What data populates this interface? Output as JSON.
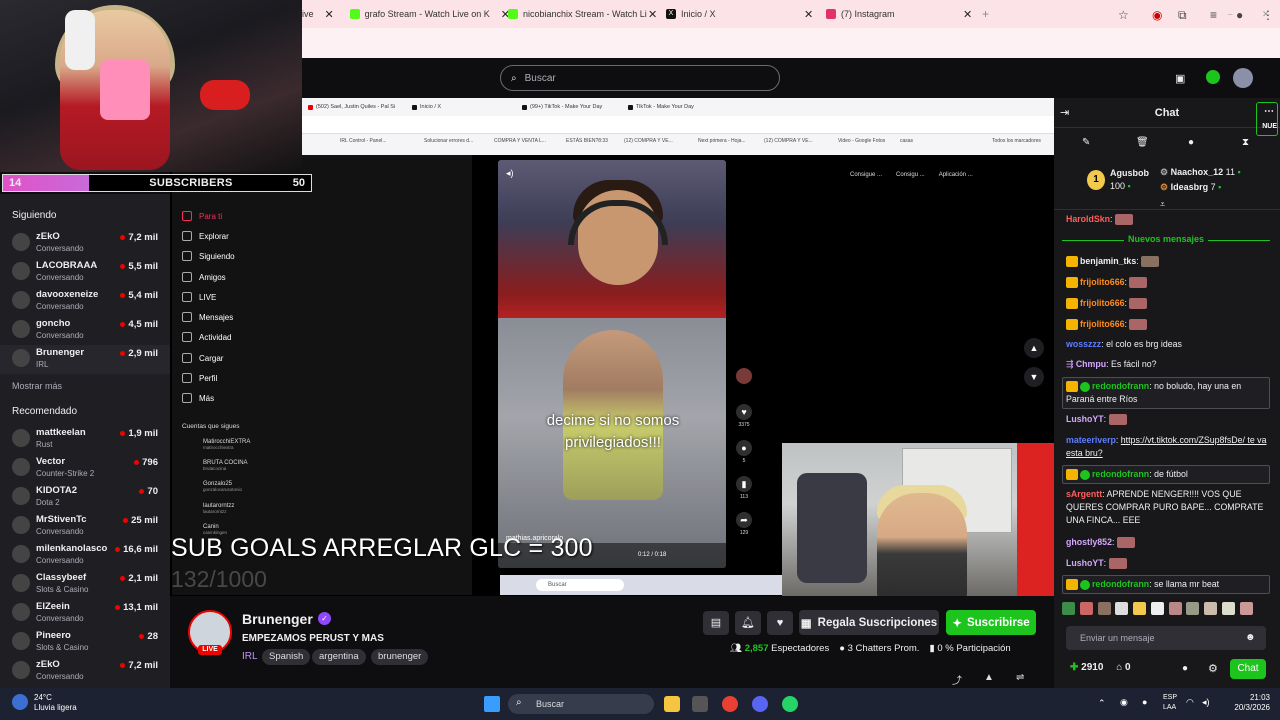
{
  "browser": {
    "tabs": [
      {
        "label": "ive",
        "color": "#9146ff"
      },
      {
        "label": "grafo Stream - Watch Live on K",
        "color": "#53fc18"
      },
      {
        "label": "nicobianchix Stream - Watch Li",
        "color": "#53fc18"
      },
      {
        "label": "Inicio / X",
        "color": "#111111"
      },
      {
        "label": "(7) Instagram",
        "color": "#e1306c"
      }
    ],
    "new_tab": "+"
  },
  "twitch": {
    "search_placeholder": "Buscar",
    "sidebar": {
      "following_header": "Siguiendo",
      "following": [
        {
          "name": "zEkO",
          "category": "Conversando",
          "viewers": "7,2 mil"
        },
        {
          "name": "LACOBRAAA",
          "category": "Conversando",
          "viewers": "5,5 mil"
        },
        {
          "name": "davooxeneize",
          "category": "Conversando",
          "viewers": "5,4 mil"
        },
        {
          "name": "goncho",
          "category": "Conversando",
          "viewers": "4,5 mil"
        },
        {
          "name": "Brunenger",
          "category": "IRL",
          "viewers": "2,9 mil"
        }
      ],
      "show_more": "Mostrar más",
      "recommended_header": "Recomendado",
      "recommended": [
        {
          "name": "mattkeelan",
          "category": "Rust",
          "viewers": "1,9 mil"
        },
        {
          "name": "Vector",
          "category": "Counter-Strike 2",
          "viewers": "796"
        },
        {
          "name": "KIDOTA2",
          "category": "Dota 2",
          "viewers": "70"
        },
        {
          "name": "MrStivenTc",
          "category": "Conversando",
          "viewers": "25 mil"
        },
        {
          "name": "milenkanolasco",
          "category": "Conversando",
          "viewers": "16,6 mil"
        },
        {
          "name": "Classybeef",
          "category": "Slots & Casino",
          "viewers": "2,1 mil"
        },
        {
          "name": "ElZeein",
          "category": "Conversando",
          "viewers": "13,1 mil"
        },
        {
          "name": "Pineero",
          "category": "Slots & Casino",
          "viewers": "28"
        },
        {
          "name": "zEkO",
          "category": "Conversando",
          "viewers": "7,2 mil"
        }
      ]
    },
    "overlay": {
      "sub_count": "14",
      "sub_label": "SUBSCRIBERS",
      "sub_goal": "50",
      "sub_progress": 0.28,
      "goals_text": "SUB GOALS ARREGLAR GLC = 300",
      "goals_count": "132/1000"
    },
    "stream_content": {
      "inner_tabs": [
        "(502) Sael, Justin Quiles - Pal Si",
        "Inicio / X",
        "(99+) TikTok - Make Your Day",
        "TikTok - Make Your Day"
      ],
      "inner_bookmarks": [
        "IRL Control - Panel...",
        "Solucionar errores d...",
        "COMPRA Y VENTA L...",
        "ESTÁS BIEN?8:33",
        "(12) COMPRA Y VE...",
        "(12) COMPRA Y VE...",
        "Next primera - Hoja...",
        "(12) COMPRA Y VE...",
        "Video - Google Fotos",
        "casas",
        "Todos los marcadores"
      ],
      "tiktok_nav": [
        "Para ti",
        "Explorar",
        "Siguiendo",
        "Amigos",
        "LIVE",
        "Mensajes",
        "Actividad",
        "Cargar",
        "Perfil",
        "Más"
      ],
      "tiktok_follow_header": "Cuentas que sigues",
      "tiktok_following": [
        {
          "name": "MatirocchiEXTRA",
          "handle": "matirocchiextra"
        },
        {
          "name": "BRUTA COCINA",
          "handle": "brutacocina"
        },
        {
          "name": "Gonzalo25",
          "handle": "gonzalocarusotonio"
        },
        {
          "name": "lautarorntzz",
          "handle": "lautarorntzz"
        },
        {
          "name": "Canin",
          "handle": "caninkingen"
        }
      ],
      "tiktok_top_actions": [
        "Consigue ...",
        "Consigu ...",
        "Aplicación ..."
      ],
      "video_caption": "decime si no somos privilegiados!!!",
      "video_user": "mathias.apricoralo",
      "video_time": "0:12 / 0:18",
      "action_counts": [
        "3375",
        "5",
        "113",
        "129"
      ],
      "inner_search": "Buscar"
    },
    "channel": {
      "name": "Brunenger",
      "live_badge": "LIVE",
      "title": "EMPEZAMOS PERUST Y MAS",
      "category": "IRL",
      "tags": [
        "Spanish",
        "argentina",
        "brunenger"
      ],
      "gift_button": "Regala Suscripciones",
      "subscribe_button": "Suscribirse",
      "viewers": "2,857",
      "viewers_label": "Espectadores",
      "chatters": "3",
      "chatters_label": "Chatters Prom.",
      "participation": "0 %",
      "participation_label": "Participación"
    },
    "chat": {
      "title": "Chat",
      "corner_badge": "NUE",
      "leaderboard": [
        {
          "name": "Agusbob",
          "value": "100"
        },
        {
          "name": "Naachox_12",
          "value": "11"
        },
        {
          "name": "Ideasbrg",
          "value": "7"
        }
      ],
      "new_messages": "Nuevos mensajes",
      "messages": [
        {
          "user": "HaroldSkn",
          "text": "",
          "color": "#ff4f4f"
        },
        {
          "user": "benjamin_tks",
          "text": "",
          "color": "#efeff1"
        },
        {
          "user": "frijolito666",
          "text": "",
          "color": "#ff8c1a"
        },
        {
          "user": "frijolito666",
          "text": "",
          "color": "#ff8c1a"
        },
        {
          "user": "frijolito666",
          "text": "",
          "color": "#ff8c1a"
        },
        {
          "user": "wosszzz",
          "text": "el colo es brg ideas",
          "color": "#5f7dff"
        },
        {
          "user": "Chmpu",
          "text": "Es fácil no?",
          "color": "#d5a6ff"
        },
        {
          "user": "redondofrann",
          "text": "no boludo, hay una en Paraná entre Ríos",
          "color": "#1ec41e"
        },
        {
          "user": "LushoYT",
          "text": "",
          "color": "#d5a6ff"
        },
        {
          "user": "mateeriverp",
          "text": "https://vt.tiktok.com/ZSup8fsDe/ te va esta bru?",
          "color": "#5f7dff"
        },
        {
          "user": "redondofrann",
          "text": "de fútbol",
          "color": "#1ec41e"
        },
        {
          "user": "sArgentt",
          "text": "APRENDE NENGER!!!! VOS QUE QUERES COMPRAR PURO BAPE... COMPRATE UNA FINCA... EEE",
          "color": "#ff5e5e"
        },
        {
          "user": "ghostly852",
          "text": "",
          "color": "#d5a6ff"
        },
        {
          "user": "LushoYT",
          "text": "",
          "color": "#d5a6ff"
        },
        {
          "user": "redondofrann",
          "text": "se llama mr beat",
          "color": "#1ec41e"
        }
      ],
      "input_placeholder": "Enviar un mensaje",
      "points": "2910",
      "second_count": "0",
      "chat_button": "Chat"
    }
  },
  "taskbar": {
    "weather_temp": "24°C",
    "weather_desc": "Lluvia ligera",
    "search": "Buscar",
    "lang1": "ESP",
    "lang2": "LAA",
    "time": "21:03",
    "date": "20/3/2026"
  },
  "colors": {
    "accent": "#1ec41e",
    "twitch_purple": "#9147ff",
    "live_red": "#eb0400"
  }
}
